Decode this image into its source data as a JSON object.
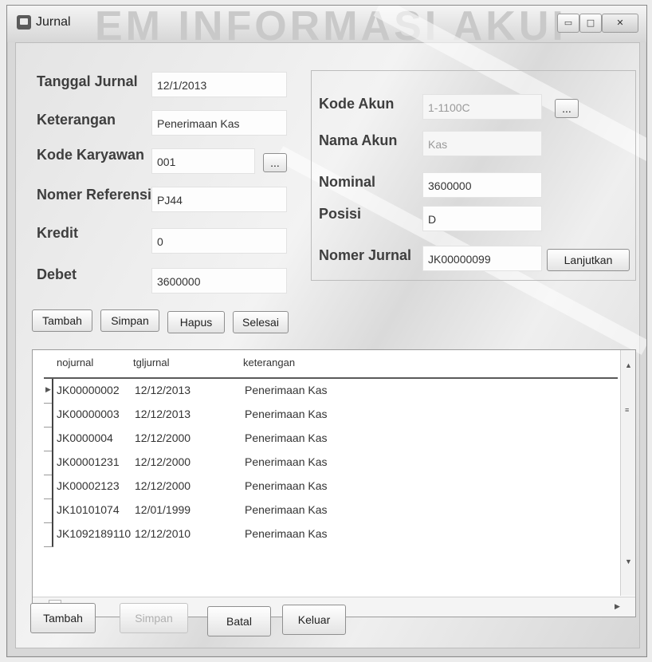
{
  "window": {
    "title": "Jurnal",
    "watermark": "EM INFORMASI AKUI",
    "controls": {
      "minimize": "▭",
      "maximize": "□",
      "close": "✕"
    }
  },
  "form": {
    "tanggal_jurnal": {
      "label": "Tanggal Jurnal",
      "value": "12/1/2013"
    },
    "keterangan": {
      "label": "Keterangan",
      "value": "Penerimaan Kas"
    },
    "kode_karyawan": {
      "label": "Kode Karyawan",
      "value": "001",
      "browse": "..."
    },
    "nomer_referensi": {
      "label": "Nomer Referensi",
      "value": "PJ44"
    },
    "kredit": {
      "label": "Kredit",
      "value": "0"
    },
    "debet": {
      "label": "Debet",
      "value": "3600000"
    },
    "kode_akun": {
      "label": "Kode Akun",
      "value": "1-1100C",
      "browse": "..."
    },
    "nama_akun": {
      "label": "Nama Akun",
      "value": "Kas"
    },
    "nominal": {
      "label": "Nominal",
      "value": "3600000"
    },
    "posisi": {
      "label": "Posisi",
      "value": "D"
    },
    "nomer_jurnal": {
      "label": "Nomer Jurnal",
      "value": "JK00000099"
    }
  },
  "buttons": {
    "lanjutkan": "Lanjutkan",
    "detail": {
      "tambah": "Tambah",
      "simpan": "Simpan",
      "hapus": "Hapus",
      "selesai": "Selesai"
    },
    "footer": {
      "tambah": "Tambah",
      "simpan": "Simpan",
      "batal": "Batal",
      "keluar": "Keluar"
    }
  },
  "grid": {
    "columns": [
      "nojurnal",
      "tgljurnal",
      "keterangan"
    ],
    "current_row_marker": "▶",
    "rows": [
      [
        "JK00000002",
        "12/12/2013",
        "Penerimaan Kas"
      ],
      [
        "JK00000003",
        "12/12/2013",
        "Penerimaan Kas"
      ],
      [
        "JK0000004",
        "12/12/2000",
        "Penerimaan Kas"
      ],
      [
        "JK00001231",
        "12/12/2000",
        "Penerimaan Kas"
      ],
      [
        "JK00002123",
        "12/12/2000",
        "Penerimaan Kas"
      ],
      [
        "JK10101074",
        "12/01/1999",
        "Penerimaan Kas"
      ],
      [
        "JK1092189110",
        "12/12/2010",
        "Penerimaan Kas"
      ]
    ]
  },
  "colors": {
    "background": "#d8d8d8",
    "label": "#3e3e3e",
    "input": "#fdfdfd"
  }
}
